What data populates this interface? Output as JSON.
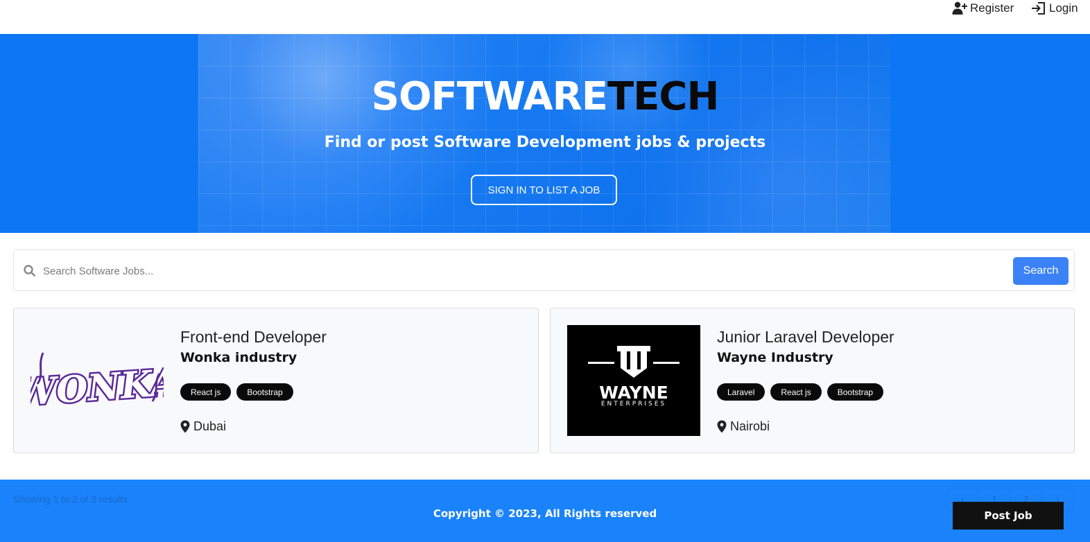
{
  "nav": {
    "register_label": "Register",
    "login_label": "Login"
  },
  "hero": {
    "brand_white": "SOFTWARE",
    "brand_dark": "TECH",
    "subtitle": "Find or post Software Development jobs & projects",
    "cta_label": "SIGN IN TO LIST A JOB"
  },
  "search": {
    "placeholder": "Search Software Jobs...",
    "button_label": "Search"
  },
  "jobs": [
    {
      "title": "Front-end Developer",
      "company": "Wonka industry",
      "logo_text": "WONKA",
      "tags": [
        "React js",
        "Bootstrap"
      ],
      "location": "Dubai"
    },
    {
      "title": "Junior Laravel Developer",
      "company": "Wayne Industry",
      "logo_text": "WAYNE",
      "logo_subtext": "ENTERPRISES",
      "tags": [
        "Laravel",
        "React js",
        "Bootstrap"
      ],
      "location": "Nairobi"
    }
  ],
  "footer": {
    "results_text": "Showing 1 to 2 of 3 results",
    "pager": [
      "‹",
      "1",
      "2",
      "›"
    ],
    "copyright": "Copyright © 2023, All Rights reserved",
    "post_job_label": "Post Job"
  },
  "colors": {
    "primary": "#0d76f5",
    "footer": "#1a82fb",
    "search_button": "#3b82f6",
    "tag": "#0a0a0a"
  }
}
